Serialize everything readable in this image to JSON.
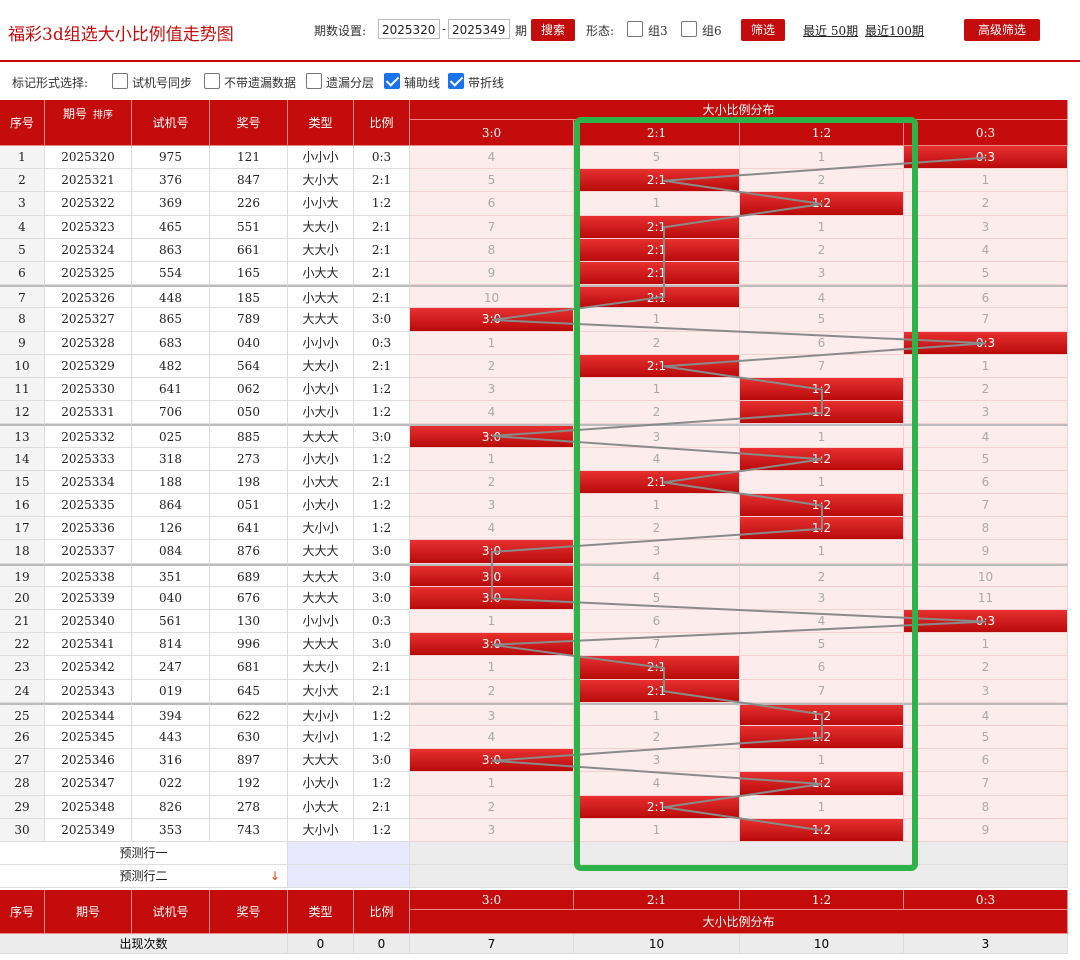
{
  "header": {
    "title": "福彩3d组选大小比例值走势图",
    "period_label": "期数设置:",
    "period_from": "2025320",
    "period_dash": "-",
    "period_to": "2025349",
    "period_unit": "期",
    "search_btn": "搜索",
    "form_label": "形态:",
    "group3": "组3",
    "group6": "组6",
    "filter_btn": "筛选",
    "recent50": "最近 50期",
    "recent100": "最近100期",
    "advanced_btn": "高级筛选"
  },
  "options": {
    "label": "标记形式选择:",
    "items": [
      {
        "label": "试机号同步",
        "checked": false
      },
      {
        "label": "不带遗漏数据",
        "checked": false
      },
      {
        "label": "遗漏分层",
        "checked": false
      },
      {
        "label": "辅助线",
        "checked": true
      },
      {
        "label": "带折线",
        "checked": true
      }
    ]
  },
  "table": {
    "headers": {
      "seq": "序号",
      "issue": "期号",
      "sort": "排序",
      "trial": "试机号",
      "prize": "奖号",
      "type": "类型",
      "ratio": "比例",
      "dist": "大小比例分布"
    },
    "ratio_cols": [
      "3:0",
      "2:1",
      "1:2",
      "0:3"
    ],
    "rows": [
      {
        "seq": "1",
        "issue": "2025320",
        "trial": "975",
        "prize": "121",
        "type": "小小小",
        "ratio": "0:3",
        "cells": [
          "4",
          "5",
          "1",
          "0:3"
        ],
        "hit": 3
      },
      {
        "seq": "2",
        "issue": "2025321",
        "trial": "376",
        "prize": "847",
        "type": "大小大",
        "ratio": "2:1",
        "cells": [
          "5",
          "2:1",
          "2",
          "1"
        ],
        "hit": 1
      },
      {
        "seq": "3",
        "issue": "2025322",
        "trial": "369",
        "prize": "226",
        "type": "小小大",
        "ratio": "1:2",
        "cells": [
          "6",
          "1",
          "1:2",
          "2"
        ],
        "hit": 2
      },
      {
        "seq": "4",
        "issue": "2025323",
        "trial": "465",
        "prize": "551",
        "type": "大大小",
        "ratio": "2:1",
        "cells": [
          "7",
          "2:1",
          "1",
          "3"
        ],
        "hit": 1
      },
      {
        "seq": "5",
        "issue": "2025324",
        "trial": "863",
        "prize": "661",
        "type": "大大小",
        "ratio": "2:1",
        "cells": [
          "8",
          "2:1",
          "2",
          "4"
        ],
        "hit": 1
      },
      {
        "seq": "6",
        "issue": "2025325",
        "trial": "554",
        "prize": "165",
        "type": "小大大",
        "ratio": "2:1",
        "cells": [
          "9",
          "2:1",
          "3",
          "5"
        ],
        "hit": 1
      },
      {
        "seq": "7",
        "issue": "2025326",
        "trial": "448",
        "prize": "185",
        "type": "小大大",
        "ratio": "2:1",
        "cells": [
          "10",
          "2:1",
          "4",
          "6"
        ],
        "hit": 1
      },
      {
        "seq": "8",
        "issue": "2025327",
        "trial": "865",
        "prize": "789",
        "type": "大大大",
        "ratio": "3:0",
        "cells": [
          "3:0",
          "1",
          "5",
          "7"
        ],
        "hit": 0
      },
      {
        "seq": "9",
        "issue": "2025328",
        "trial": "683",
        "prize": "040",
        "type": "小小小",
        "ratio": "0:3",
        "cells": [
          "1",
          "2",
          "6",
          "0:3"
        ],
        "hit": 3
      },
      {
        "seq": "10",
        "issue": "2025329",
        "trial": "482",
        "prize": "564",
        "type": "大大小",
        "ratio": "2:1",
        "cells": [
          "2",
          "2:1",
          "7",
          "1"
        ],
        "hit": 1
      },
      {
        "seq": "11",
        "issue": "2025330",
        "trial": "641",
        "prize": "062",
        "type": "小大小",
        "ratio": "1:2",
        "cells": [
          "3",
          "1",
          "1:2",
          "2"
        ],
        "hit": 2
      },
      {
        "seq": "12",
        "issue": "2025331",
        "trial": "706",
        "prize": "050",
        "type": "小大小",
        "ratio": "1:2",
        "cells": [
          "4",
          "2",
          "1:2",
          "3"
        ],
        "hit": 2
      },
      {
        "seq": "13",
        "issue": "2025332",
        "trial": "025",
        "prize": "885",
        "type": "大大大",
        "ratio": "3:0",
        "cells": [
          "3:0",
          "3",
          "1",
          "4"
        ],
        "hit": 0
      },
      {
        "seq": "14",
        "issue": "2025333",
        "trial": "318",
        "prize": "273",
        "type": "小大小",
        "ratio": "1:2",
        "cells": [
          "1",
          "4",
          "1:2",
          "5"
        ],
        "hit": 2
      },
      {
        "seq": "15",
        "issue": "2025334",
        "trial": "188",
        "prize": "198",
        "type": "小大大",
        "ratio": "2:1",
        "cells": [
          "2",
          "2:1",
          "1",
          "6"
        ],
        "hit": 1
      },
      {
        "seq": "16",
        "issue": "2025335",
        "trial": "864",
        "prize": "051",
        "type": "小大小",
        "ratio": "1:2",
        "cells": [
          "3",
          "1",
          "1:2",
          "7"
        ],
        "hit": 2
      },
      {
        "seq": "17",
        "issue": "2025336",
        "trial": "126",
        "prize": "641",
        "type": "大小小",
        "ratio": "1:2",
        "cells": [
          "4",
          "2",
          "1:2",
          "8"
        ],
        "hit": 2
      },
      {
        "seq": "18",
        "issue": "2025337",
        "trial": "084",
        "prize": "876",
        "type": "大大大",
        "ratio": "3:0",
        "cells": [
          "3:0",
          "3",
          "1",
          "9"
        ],
        "hit": 0
      },
      {
        "seq": "19",
        "issue": "2025338",
        "trial": "351",
        "prize": "689",
        "type": "大大大",
        "ratio": "3:0",
        "cells": [
          "3:0",
          "4",
          "2",
          "10"
        ],
        "hit": 0
      },
      {
        "seq": "20",
        "issue": "2025339",
        "trial": "040",
        "prize": "676",
        "type": "大大大",
        "ratio": "3:0",
        "cells": [
          "3:0",
          "5",
          "3",
          "11"
        ],
        "hit": 0
      },
      {
        "seq": "21",
        "issue": "2025340",
        "trial": "561",
        "prize": "130",
        "type": "小小小",
        "ratio": "0:3",
        "cells": [
          "1",
          "6",
          "4",
          "0:3"
        ],
        "hit": 3
      },
      {
        "seq": "22",
        "issue": "2025341",
        "trial": "814",
        "prize": "996",
        "type": "大大大",
        "ratio": "3:0",
        "cells": [
          "3:0",
          "7",
          "5",
          "1"
        ],
        "hit": 0
      },
      {
        "seq": "23",
        "issue": "2025342",
        "trial": "247",
        "prize": "681",
        "type": "大大小",
        "ratio": "2:1",
        "cells": [
          "1",
          "2:1",
          "6",
          "2"
        ],
        "hit": 1
      },
      {
        "seq": "24",
        "issue": "2025343",
        "trial": "019",
        "prize": "645",
        "type": "大小大",
        "ratio": "2:1",
        "cells": [
          "2",
          "2:1",
          "7",
          "3"
        ],
        "hit": 1
      },
      {
        "seq": "25",
        "issue": "2025344",
        "trial": "394",
        "prize": "622",
        "type": "大小小",
        "ratio": "1:2",
        "cells": [
          "3",
          "1",
          "1:2",
          "4"
        ],
        "hit": 2
      },
      {
        "seq": "26",
        "issue": "2025345",
        "trial": "443",
        "prize": "630",
        "type": "大小小",
        "ratio": "1:2",
        "cells": [
          "4",
          "2",
          "1:2",
          "5"
        ],
        "hit": 2
      },
      {
        "seq": "27",
        "issue": "2025346",
        "trial": "316",
        "prize": "897",
        "type": "大大大",
        "ratio": "3:0",
        "cells": [
          "3:0",
          "3",
          "1",
          "6"
        ],
        "hit": 0
      },
      {
        "seq": "28",
        "issue": "2025347",
        "trial": "022",
        "prize": "192",
        "type": "小大小",
        "ratio": "1:2",
        "cells": [
          "1",
          "4",
          "1:2",
          "7"
        ],
        "hit": 2
      },
      {
        "seq": "29",
        "issue": "2025348",
        "trial": "826",
        "prize": "278",
        "type": "小大大",
        "ratio": "2:1",
        "cells": [
          "2",
          "2:1",
          "1",
          "8"
        ],
        "hit": 1
      },
      {
        "seq": "30",
        "issue": "2025349",
        "trial": "353",
        "prize": "743",
        "type": "大小小",
        "ratio": "1:2",
        "cells": [
          "3",
          "1",
          "1:2",
          "9"
        ],
        "hit": 2
      }
    ],
    "predict1": "预测行一",
    "predict2": "预测行二",
    "count_label": "出现次数",
    "counts": {
      "type": "0",
      "ratio": "0",
      "cells": [
        "7",
        "10",
        "10",
        "3"
      ]
    }
  },
  "colors": {
    "brand": "#c40c0c",
    "highlight_box": "#2db34a"
  }
}
